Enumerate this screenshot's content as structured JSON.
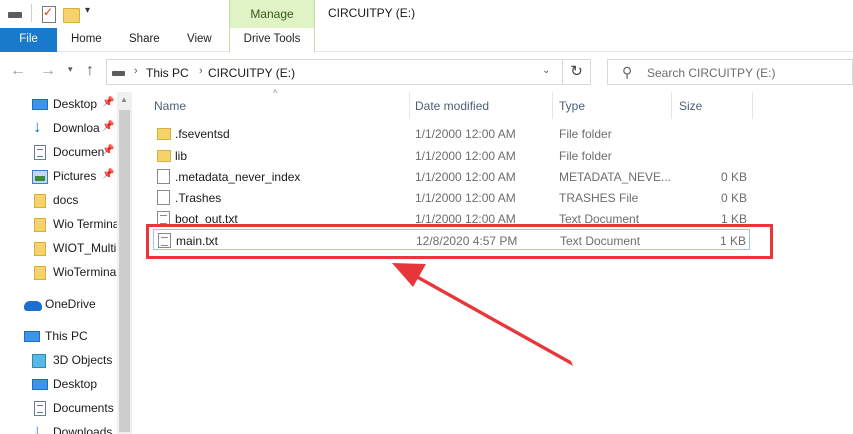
{
  "window": {
    "title": "CIRCUITPY (E:)",
    "manage_label": "Manage",
    "quick_access_more": "▾"
  },
  "ribbon": {
    "tabs": [
      {
        "label": "File"
      },
      {
        "label": "Home"
      },
      {
        "label": "Share"
      },
      {
        "label": "View"
      },
      {
        "label": "Drive Tools"
      }
    ]
  },
  "address": {
    "segments": [
      "This PC",
      "CIRCUITPY (E:)"
    ],
    "search_placeholder": "Search CIRCUITPY (E:)"
  },
  "sidebar": {
    "items": [
      {
        "label": "Desktop",
        "icon": "desktop-icon",
        "pinned": true
      },
      {
        "label": "Downloa",
        "icon": "downloads-icon",
        "pinned": true
      },
      {
        "label": "Documen",
        "icon": "documents-icon",
        "pinned": true
      },
      {
        "label": "Pictures",
        "icon": "pictures-icon",
        "pinned": true
      },
      {
        "label": "docs",
        "icon": "folder-icon",
        "pinned": false
      },
      {
        "label": "Wio Termina",
        "icon": "folder-icon",
        "pinned": false
      },
      {
        "label": "WIOT_MultiS",
        "icon": "folder-icon",
        "pinned": false
      },
      {
        "label": "WioTermina",
        "icon": "folder-icon",
        "pinned": false
      },
      {
        "label": "OneDrive",
        "icon": "onedrive-icon",
        "pinned": false
      },
      {
        "label": "This PC",
        "icon": "this-pc-icon",
        "pinned": false
      },
      {
        "label": "3D Objects",
        "icon": "3d-objects-icon",
        "pinned": false
      },
      {
        "label": "Desktop",
        "icon": "desktop-icon",
        "pinned": false
      },
      {
        "label": "Documents",
        "icon": "documents-icon",
        "pinned": false
      },
      {
        "label": "Downloads",
        "icon": "downloads-icon",
        "pinned": false
      }
    ]
  },
  "columns": {
    "name": "Name",
    "date": "Date modified",
    "type": "Type",
    "size": "Size"
  },
  "files": [
    {
      "name": ".fseventsd",
      "date": "1/1/2000 12:00 AM",
      "type": "File folder",
      "size": "",
      "icon": "folder-icon"
    },
    {
      "name": "lib",
      "date": "1/1/2000 12:00 AM",
      "type": "File folder",
      "size": "",
      "icon": "folder-icon"
    },
    {
      "name": ".metadata_never_index",
      "date": "1/1/2000 12:00 AM",
      "type": "METADATA_NEVE...",
      "size": "0 KB",
      "icon": "file-icon"
    },
    {
      "name": ".Trashes",
      "date": "1/1/2000 12:00 AM",
      "type": "TRASHES File",
      "size": "0 KB",
      "icon": "file-icon"
    },
    {
      "name": "boot_out.txt",
      "date": "1/1/2000 12:00 AM",
      "type": "Text Document",
      "size": "1 KB",
      "icon": "text-file-icon"
    },
    {
      "name": "main.txt",
      "date": "12/8/2020 4:57 PM",
      "type": "Text Document",
      "size": "1 KB",
      "icon": "text-file-icon"
    }
  ],
  "annotation": {
    "highlight_color": "#e8373a",
    "highlighted_file": "main.txt"
  }
}
